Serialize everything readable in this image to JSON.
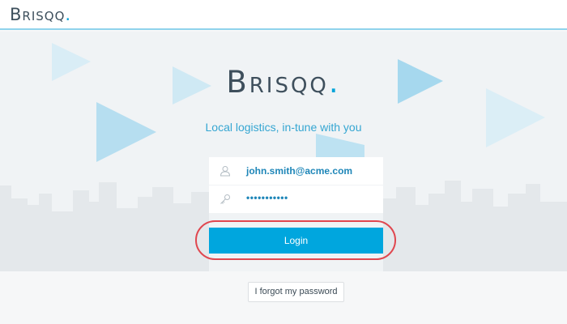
{
  "header": {
    "logo_text": "Brisqq",
    "logo_dot": "."
  },
  "hero": {
    "brand_text": "Brisqq",
    "brand_dot": ".",
    "tagline": "Local logistics, in-tune with you"
  },
  "login_form": {
    "email_icon": "user-icon",
    "email_value": "john.smith@acme.com",
    "password_icon": "key-icon",
    "password_value": "•••••••••••",
    "login_label": "Login",
    "forgot_label": "I forgot my password"
  },
  "colors": {
    "accent": "#00a6de",
    "brand_dark": "#3e4f5c",
    "highlight_ring": "#e0474f"
  }
}
